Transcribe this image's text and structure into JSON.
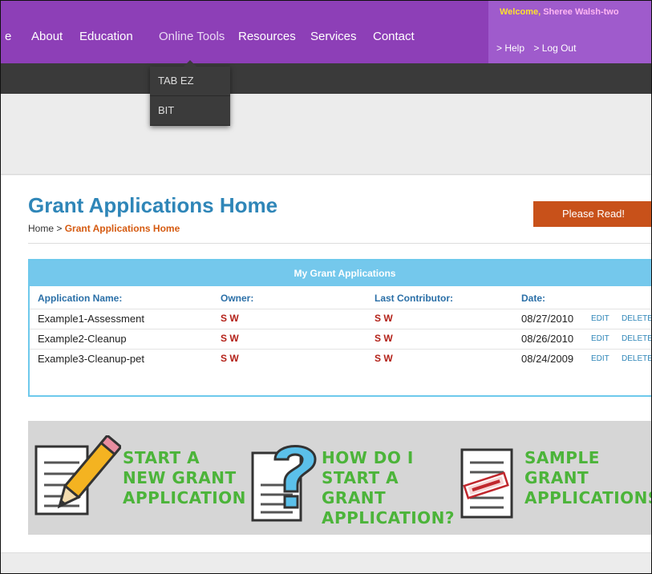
{
  "nav": {
    "items": [
      {
        "label": "e"
      },
      {
        "label": "About"
      },
      {
        "label": "Education"
      },
      {
        "label": "Online Tools"
      },
      {
        "label": "Resources"
      },
      {
        "label": "Services"
      },
      {
        "label": "Contact"
      }
    ],
    "dropdown": [
      "TAB EZ",
      "BIT"
    ]
  },
  "user": {
    "welcome_label": "Welcome,",
    "name": "Sheree Walsh-two",
    "help_link": "> Help",
    "logout_link": "> Log Out"
  },
  "page": {
    "title": "Grant Applications Home",
    "breadcrumb_home": "Home",
    "breadcrumb_sep": " > ",
    "breadcrumb_current": "Grant Applications Home",
    "read_button": "Please Read!"
  },
  "table": {
    "title": "My Grant Applications",
    "columns": [
      "Application Name:",
      "Owner:",
      "Last Contributor:",
      "Date:"
    ],
    "edit_label": "EDIT",
    "delete_label": "DELETE",
    "rows": [
      {
        "name": "Example1-Assessment",
        "owner": "S W",
        "contributor": "S W",
        "date": "08/27/2010"
      },
      {
        "name": "Example2-Cleanup",
        "owner": "S W",
        "contributor": "S W",
        "date": "08/26/2010"
      },
      {
        "name": "Example3-Cleanup-pet",
        "owner": "S W",
        "contributor": "S W",
        "date": "08/24/2009"
      }
    ]
  },
  "promos": [
    {
      "text": "START A\nNEW GRANT\nAPPLICATION",
      "icon": "pencil-document-icon"
    },
    {
      "text": "HOW DO I\nSTART A GRANT\nAPPLICATION?",
      "icon": "question-document-icon"
    },
    {
      "text": "SAMPLE\nGRANT\nAPPLICATIONS",
      "icon": "sample-stamp-document-icon"
    }
  ],
  "colors": {
    "nav_purple": "#8d3fb7",
    "title_blue": "#2f86b8",
    "button_orange": "#c8511a",
    "promo_green": "#4cb43a",
    "table_header": "#74c8ec"
  }
}
